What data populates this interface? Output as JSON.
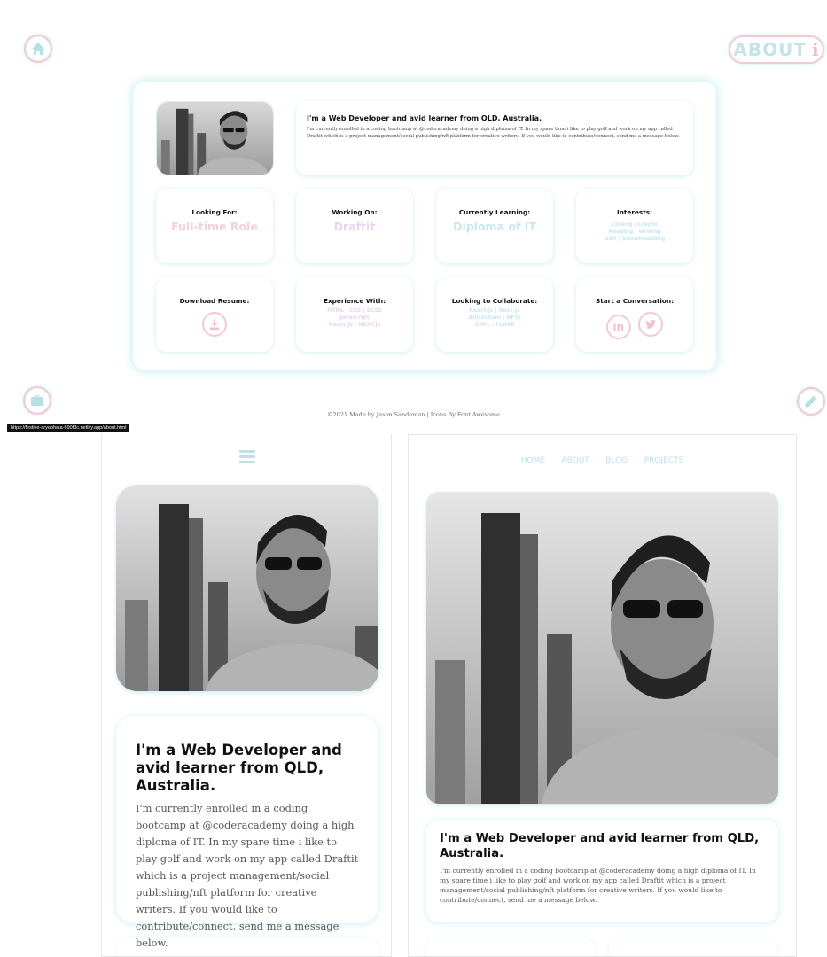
{
  "header": {
    "about_label": "ABOUT",
    "about_icon_glyph": "i"
  },
  "icons": {
    "home": "home-icon",
    "briefcase": "briefcase-icon",
    "pencil": "pencil-icon",
    "download": "download-icon",
    "linkedin": "linkedin-icon",
    "twitter": "twitter-icon",
    "menu": "hamburger-menu-icon"
  },
  "intro": {
    "heading": "I'm a Web Developer and avid learner from QLD, Australia.",
    "body": "I'm currently enrolled in a coding bootcamp at @coderacademy doing a high diploma of IT. In my spare time i like to play golf and work on my app called Draftit which is a project management/social publishing/nft platform for creative writers. If you would like to contribute/connect, send me a message below."
  },
  "cards": {
    "looking_for": {
      "title": "Looking For:",
      "value": "Full-time Role"
    },
    "working_on": {
      "title": "Working On:",
      "value": "Draftit"
    },
    "learning": {
      "title": "Currently Learning:",
      "value": "Diploma of IT"
    },
    "interests": {
      "title": "Interests:",
      "line1": "Coding | Crypto",
      "line2": "Reading | Writing",
      "line3": "Golf | Snowboarding"
    },
    "resume": {
      "title": "Download Resume:"
    },
    "experience": {
      "title": "Experience With:",
      "line1": "HTML | CSS | SCSS",
      "line2": "Javascript",
      "line3": "React.js | NEXT.js"
    },
    "collaborate": {
      "title": "Looking to Collaborate:",
      "line1": "React.js | Next.js",
      "line2": "Blockchain | NFTs",
      "line3": "XRPL | FLARE"
    },
    "conversation": {
      "title": "Start a Conversation:",
      "linkedin_glyph": "in"
    }
  },
  "footer": {
    "text": "©2021 Made by Jason Sandeman | Icons By Font Awesome"
  },
  "status_url": "https://festive-aryabhata-690f3c.netlify.app/about.html",
  "tablet_nav": [
    "HOME",
    "ABOUT",
    "BLOG",
    "PROJECTS"
  ],
  "colors": {
    "accent_aqua": "#bde1e8",
    "accent_pink": "#f5c9d4",
    "accent_lavender": "#ead3f0"
  }
}
